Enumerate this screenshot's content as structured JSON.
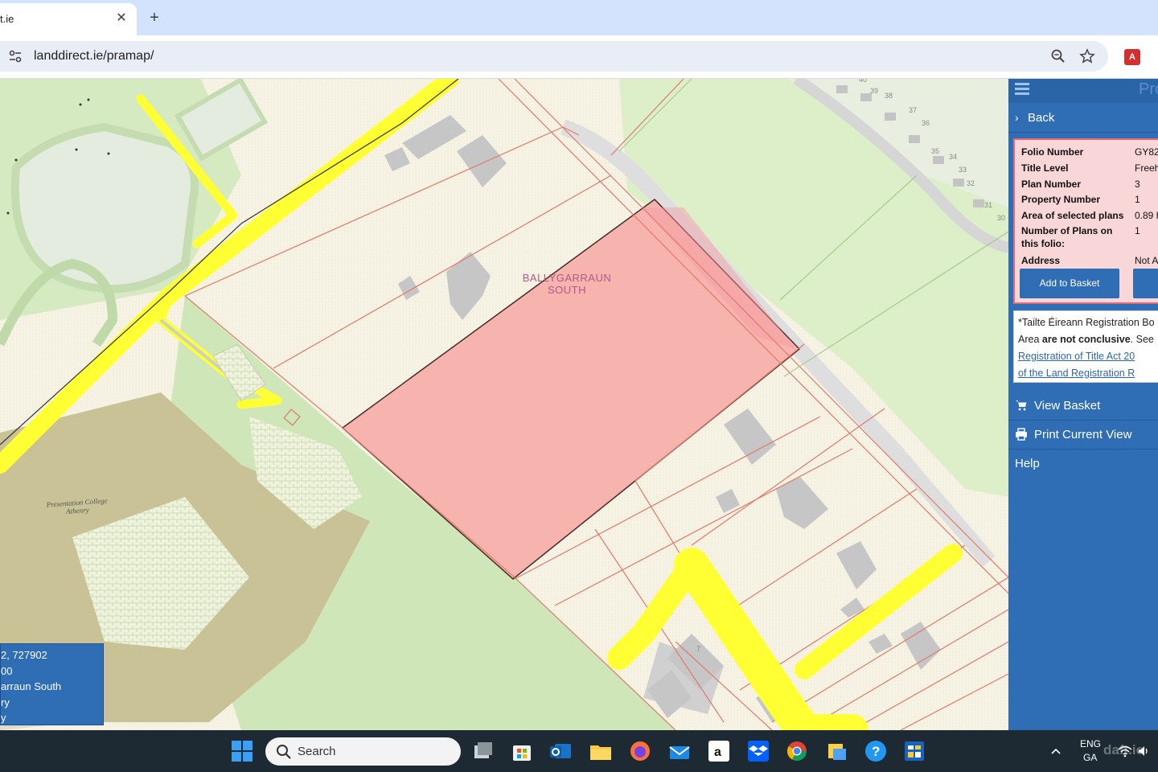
{
  "browser": {
    "tab_title": "t.ie",
    "url": "landdirect.ie/pramap/"
  },
  "map": {
    "townland_label_line1": "BALLYGARRAUN",
    "townland_label_line2": "SOUTH",
    "college_label_line1": "Presentation College",
    "college_label_line2": "Athenry",
    "house_numbers": [
      "40",
      "39",
      "38",
      "37",
      "36",
      "35",
      "34",
      "33",
      "32",
      "31",
      "30",
      "7"
    ],
    "colors": {
      "selected_plot": "#f7b3ae",
      "road_highlight": "#ffff33",
      "boundary": "#e07a6a",
      "grass": "#d8ecc6",
      "building": "#c4c4c4",
      "school": "#c7c196"
    }
  },
  "coord_box": {
    "lines": [
      "2, 727902",
      "00",
      "arraun South",
      "ry",
      "y"
    ]
  },
  "sidebar": {
    "title": "Pro",
    "back_label": "Back",
    "info": [
      {
        "key": "Folio Number",
        "value": "GY82"
      },
      {
        "key": "Title Level",
        "value": "Freeh"
      },
      {
        "key": "Plan Number",
        "value": "3"
      },
      {
        "key": "Property Number",
        "value": "1"
      },
      {
        "key": "Area of selected plans",
        "value": "0.89 h"
      },
      {
        "key_line1": "Number of Plans on",
        "key_line2": "this folio:",
        "value": "1"
      },
      {
        "key": "Address",
        "value": "Not A"
      }
    ],
    "add_to_basket_label": "Add to Basket",
    "note": {
      "line1": "*Tailte Éireann Registration Bo",
      "line2_pre": "Area ",
      "line2_bold": "are not conclusive",
      "line2_post": ". See",
      "link1": "Registration of Title Act 20",
      "link2": "of the Land Registration R"
    },
    "menu": {
      "view_basket": "View Basket",
      "print_view": "Print Current View",
      "help": "Help"
    }
  },
  "taskbar": {
    "search_label": "Search",
    "lang_top": "ENG",
    "lang_bottom": "GA",
    "watermark": "daft.ie"
  }
}
